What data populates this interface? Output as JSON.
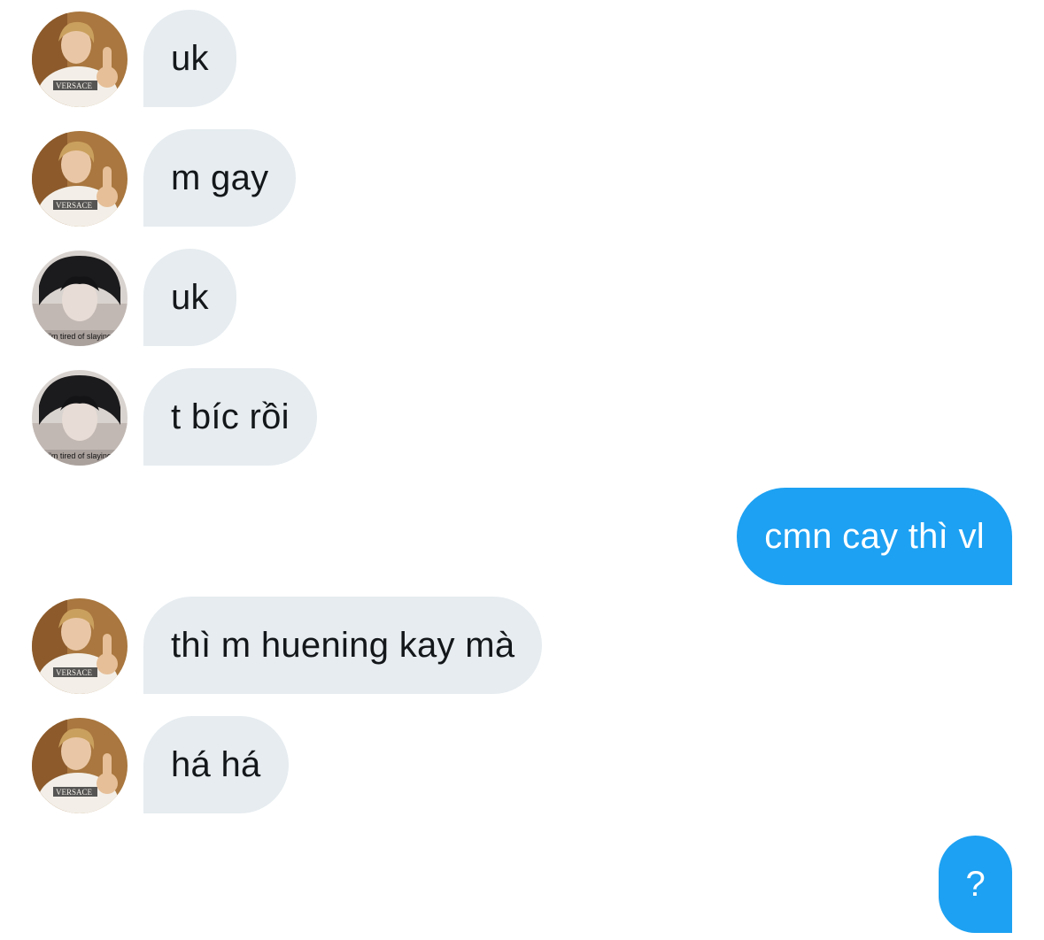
{
  "conversation": {
    "messages": [
      {
        "direction": "received",
        "avatar": "avatar-blonde",
        "text": "uk"
      },
      {
        "direction": "received",
        "avatar": "avatar-blonde",
        "text": "m gay"
      },
      {
        "direction": "received",
        "avatar": "avatar-dark",
        "text": "uk"
      },
      {
        "direction": "received",
        "avatar": "avatar-dark",
        "text": "t bíc rồi"
      },
      {
        "direction": "sent",
        "text": "cmn cay thì vl"
      },
      {
        "direction": "received",
        "avatar": "avatar-blonde",
        "text": "thì m huening kay mà"
      },
      {
        "direction": "received",
        "avatar": "avatar-blonde",
        "text": "há há"
      },
      {
        "direction": "sent",
        "text": "?"
      }
    ],
    "avatar_caption_dark": "i'm tired of slaying",
    "avatar_shirt_text": "VERSACE"
  },
  "colors": {
    "received_bubble": "#e6ecf0",
    "received_text": "#14171a",
    "sent_bubble": "#1da1f2",
    "sent_text": "#ffffff",
    "background": "#ffffff"
  }
}
